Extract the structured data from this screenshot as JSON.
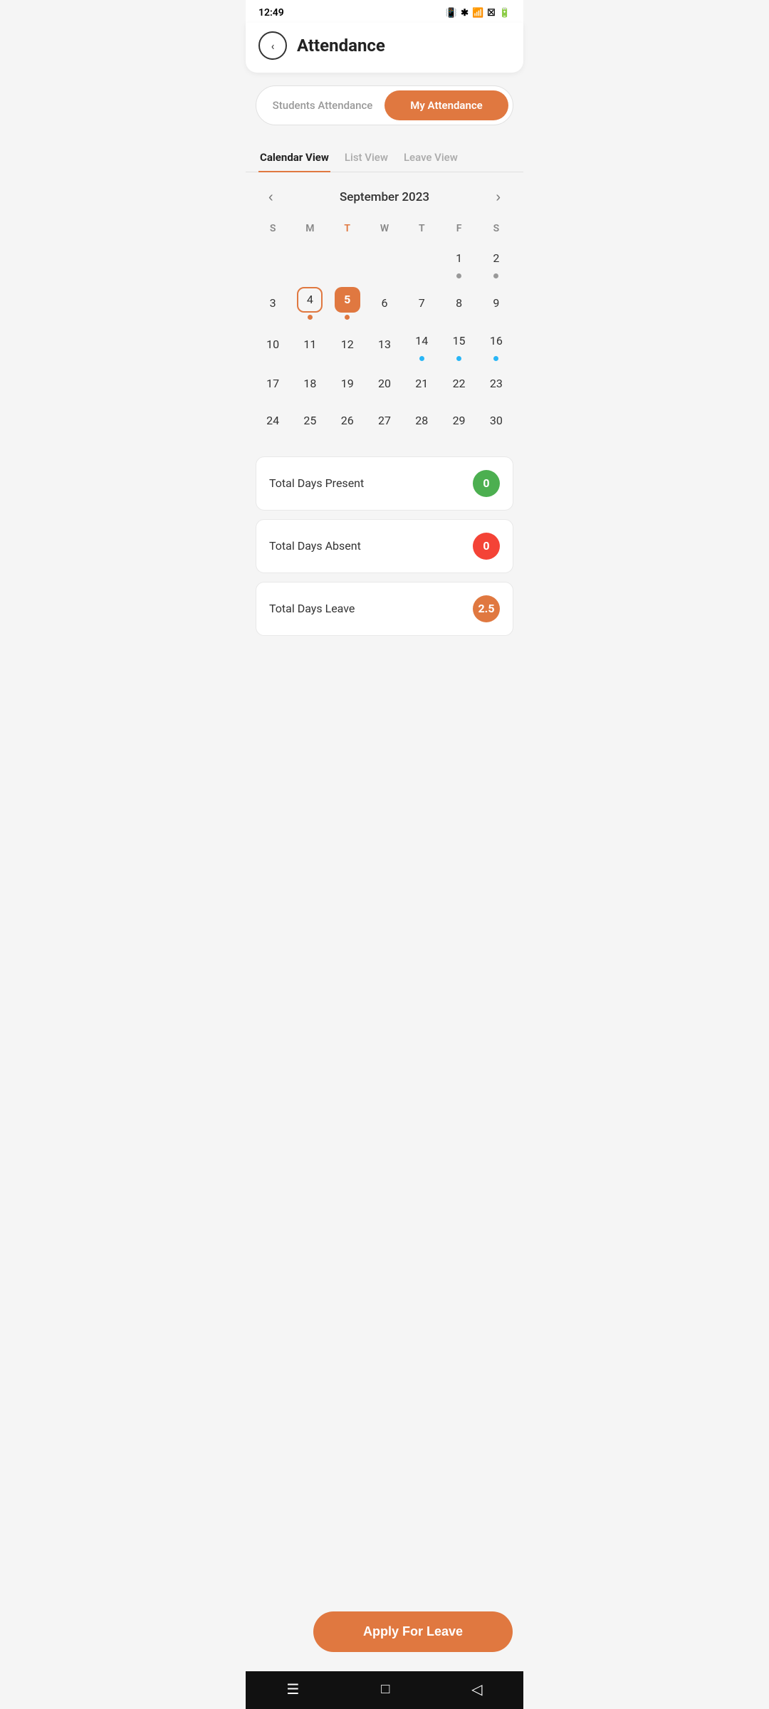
{
  "statusBar": {
    "time": "12:49",
    "icons": "vibrate bluetooth wifi signal battery"
  },
  "header": {
    "backLabel": "‹",
    "title": "Attendance"
  },
  "toggleTabs": {
    "tab1": "Students Attendance",
    "tab2": "My Attendance",
    "active": "tab2"
  },
  "viewTabs": [
    {
      "id": "calendar",
      "label": "Calendar View",
      "active": true
    },
    {
      "id": "list",
      "label": "List View",
      "active": false
    },
    {
      "id": "leave",
      "label": "Leave View",
      "active": false
    }
  ],
  "calendar": {
    "monthLabel": "September 2023",
    "dayHeaders": [
      "S",
      "M",
      "T",
      "W",
      "T",
      "F",
      "S"
    ],
    "highlightDayIndex": 2,
    "today": "5",
    "todayBorder": "4"
  },
  "stats": [
    {
      "label": "Total Days Present",
      "value": "0",
      "badgeClass": "badge-green"
    },
    {
      "label": "Total Days Absent",
      "value": "0",
      "badgeClass": "badge-red"
    },
    {
      "label": "Total Days Leave",
      "value": "2.5",
      "badgeClass": "badge-orange"
    }
  ],
  "applyLeaveBtn": "Apply For Leave",
  "calendarDots": {
    "1": "gray",
    "2": "gray",
    "4": "orange",
    "5": "orange",
    "14": "blue",
    "15": "blue",
    "16": "blue"
  }
}
